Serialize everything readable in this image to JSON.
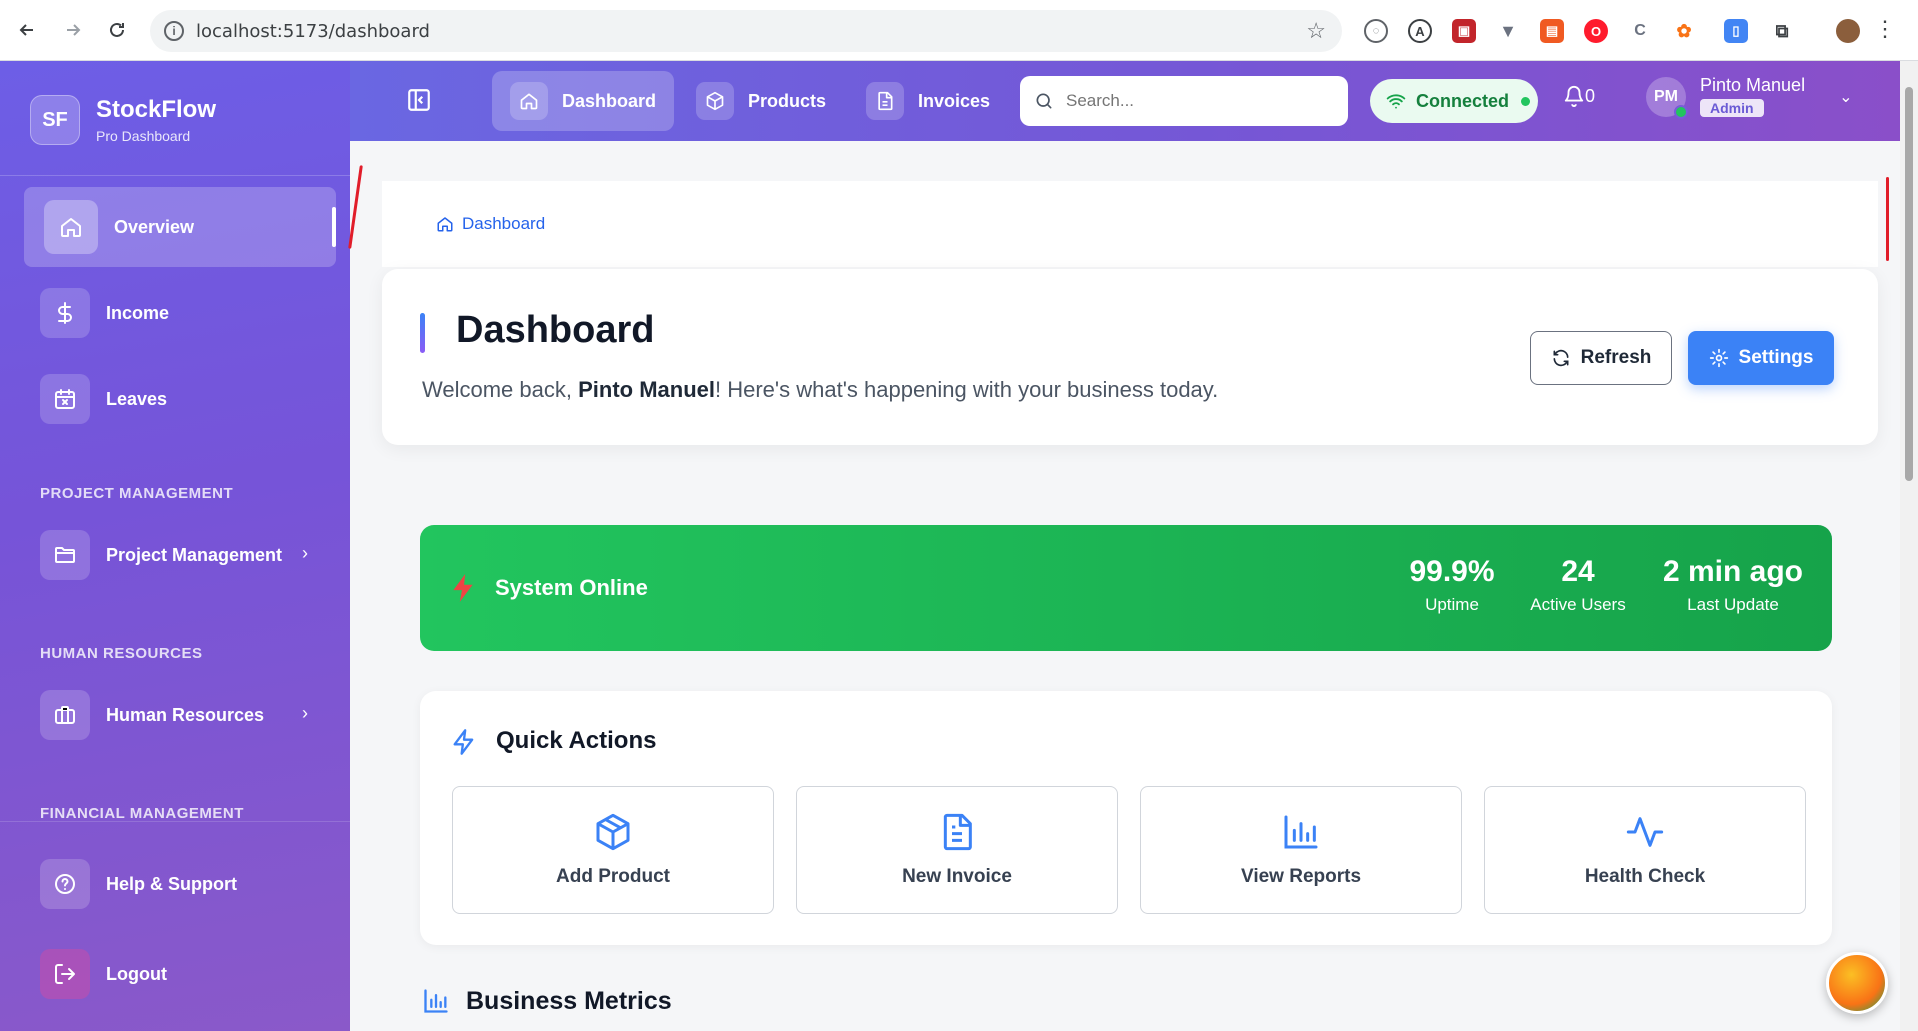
{
  "browser": {
    "url": "localhost:5173/dashboard"
  },
  "sidebar": {
    "brand_logo": "SF",
    "brand_name": "StockFlow",
    "brand_sub": "Pro Dashboard",
    "items": [
      {
        "label": "Overview",
        "icon": "home-icon"
      },
      {
        "label": "Income",
        "icon": "dollar-icon"
      },
      {
        "label": "Leaves",
        "icon": "calendar-icon"
      }
    ],
    "sections": [
      {
        "title": "PROJECT MANAGEMENT",
        "item": "Project Management"
      },
      {
        "title": "HUMAN RESOURCES",
        "item": "Human Resources"
      },
      {
        "title": "FINANCIAL MANAGEMENT"
      }
    ],
    "bottom": [
      {
        "label": "Help & Support",
        "icon": "help-icon"
      },
      {
        "label": "Logout",
        "icon": "logout-icon"
      }
    ]
  },
  "topbar": {
    "tabs": [
      {
        "label": "Dashboard",
        "icon": "home-icon"
      },
      {
        "label": "Products",
        "icon": "box-icon"
      },
      {
        "label": "Invoices",
        "icon": "document-icon"
      }
    ],
    "search_placeholder": "Search...",
    "connection": "Connected",
    "notifications": "0",
    "user": {
      "initials": "PM",
      "name": "Pinto Manuel",
      "role": "Admin"
    }
  },
  "breadcrumb": "Dashboard",
  "header": {
    "title": "Dashboard",
    "welcome_prefix": "Welcome back, ",
    "welcome_name": "Pinto Manuel",
    "welcome_suffix": "! Here's what's happening with your business today.",
    "refresh": "Refresh",
    "settings": "Settings"
  },
  "status": {
    "label": "System Online",
    "stats": [
      {
        "value": "99.9%",
        "label": "Uptime"
      },
      {
        "value": "24",
        "label": "Active Users"
      },
      {
        "value": "2 min ago",
        "label": "Last Update"
      }
    ]
  },
  "quick_actions": {
    "title": "Quick Actions",
    "items": [
      {
        "label": "Add Product",
        "icon": "box-icon"
      },
      {
        "label": "New Invoice",
        "icon": "document-icon"
      },
      {
        "label": "View Reports",
        "icon": "bar-chart-icon"
      },
      {
        "label": "Health Check",
        "icon": "activity-icon"
      }
    ]
  },
  "metrics_title": "Business Metrics",
  "colors": {
    "primary": "#3b82f6",
    "sidebar": "#7654d8",
    "success": "#22c55e"
  }
}
